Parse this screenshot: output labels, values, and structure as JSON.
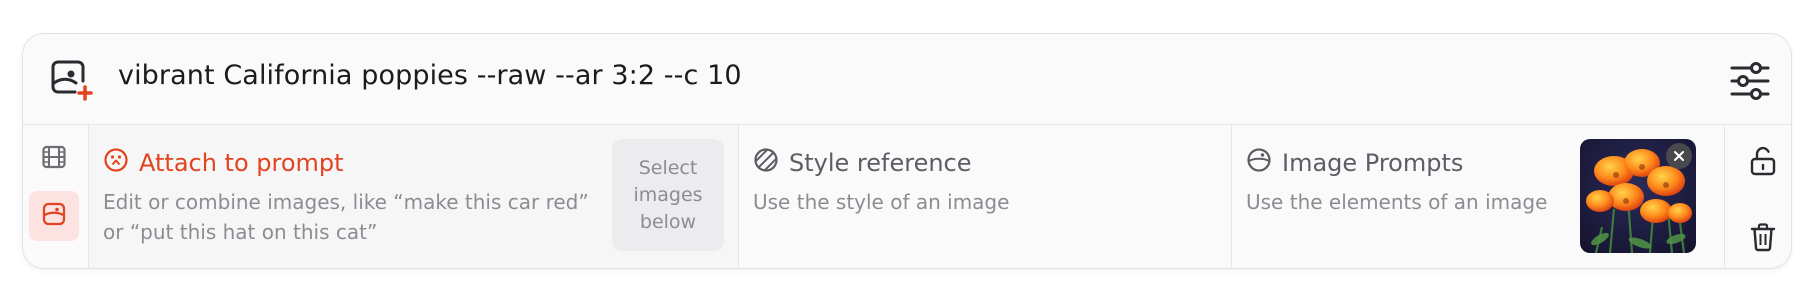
{
  "prompt": {
    "text": "vibrant California poppies --raw --ar 3:2 --c 10",
    "icon": "image-add-icon",
    "settings_icon": "sliders-icon"
  },
  "tools": [
    {
      "icon": "film-icon",
      "active": false
    },
    {
      "icon": "image-prompt-icon",
      "active": true
    }
  ],
  "sections": {
    "attach": {
      "icon": "face-target-icon",
      "title": "Attach to prompt",
      "desc_line1": "Edit or combine images, like “make this car red”",
      "desc_line2": "or “put this hat on this cat”",
      "select_lines": [
        "Select",
        "images",
        "below"
      ]
    },
    "style": {
      "icon": "stripes-circle-icon",
      "title": "Style reference",
      "desc": "Use the style of an image"
    },
    "image": {
      "icon": "half-image-circle-icon",
      "title": "Image Prompts",
      "desc": "Use the elements of an image",
      "thumbnail_alt": "California poppies",
      "remove_icon": "close-icon"
    }
  },
  "actions": [
    {
      "icon": "unlock-icon"
    },
    {
      "icon": "trash-icon"
    }
  ],
  "colors": {
    "accent": "#e2441f",
    "muted_text": "#8c8c93",
    "title_text": "#5d5d66",
    "active_bg": "#fde2e2"
  }
}
